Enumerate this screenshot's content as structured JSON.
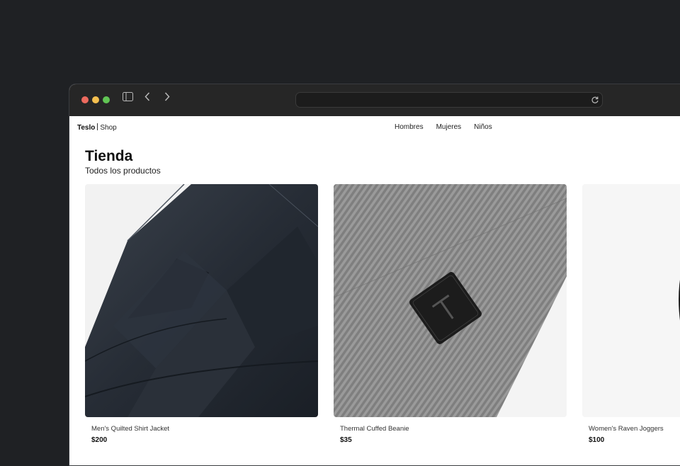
{
  "site": {
    "brand": "Teslo",
    "section": "Shop"
  },
  "nav": [
    "Hombres",
    "Mujeres",
    "Niños"
  ],
  "page": {
    "title": "Tienda",
    "subtitle": "Todos los productos"
  },
  "products": [
    {
      "name": "Men's Quilted Shirt Jacket",
      "price": "$200"
    },
    {
      "name": "Thermal Cuffed Beanie",
      "price": "$35"
    },
    {
      "name": "Women's Raven Joggers",
      "price": "$100"
    }
  ],
  "colors": {
    "chrome": "#262626",
    "background": "#1f2124",
    "accent": "#111111"
  }
}
